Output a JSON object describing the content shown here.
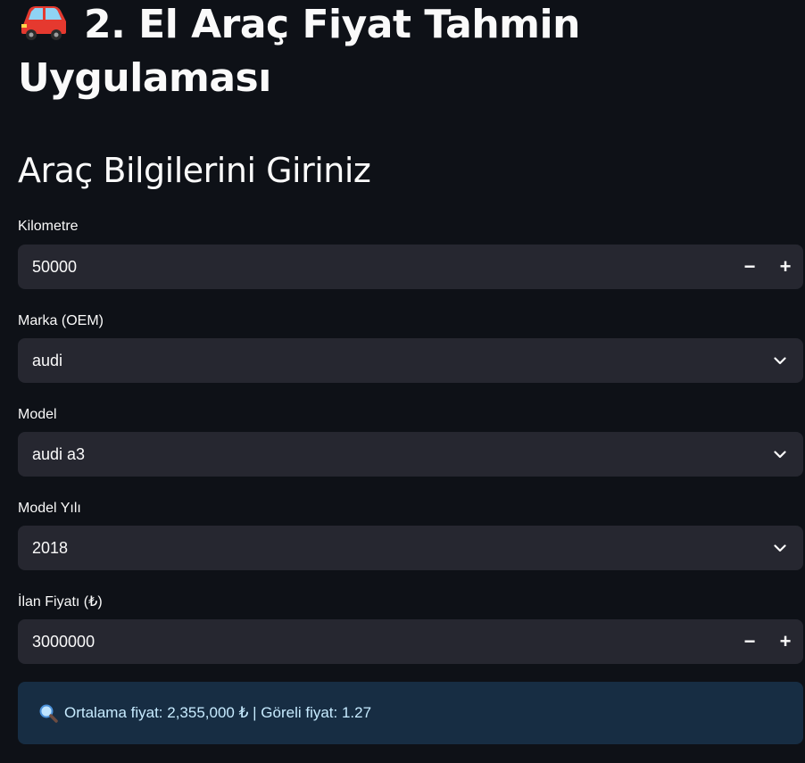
{
  "header": {
    "title": "2. El Araç Fiyat Tahmin Uygulaması",
    "title_icon": "red-car-emoji"
  },
  "form": {
    "heading": "Araç Bilgilerini Giriniz",
    "kilometre": {
      "label": "Kilometre",
      "value": "50000",
      "minus": "−",
      "plus": "+"
    },
    "marka": {
      "label": "Marka (OEM)",
      "value": "audi"
    },
    "model": {
      "label": "Model",
      "value": "audi a3"
    },
    "model_yili": {
      "label": "Model Yılı",
      "value": "2018"
    },
    "ilan_fiyati": {
      "label": "İlan Fiyatı (₺)",
      "value": "3000000",
      "minus": "−",
      "plus": "+"
    }
  },
  "result": {
    "icon": "magnifier-icon",
    "text": "Ortalama fiyat: 2,355,000 ₺ | Göreli fiyat: 1.27"
  },
  "colors": {
    "background": "#0e1117",
    "input_bg": "#262730",
    "info_bg": "#172d43",
    "info_text": "#c7ebff"
  }
}
